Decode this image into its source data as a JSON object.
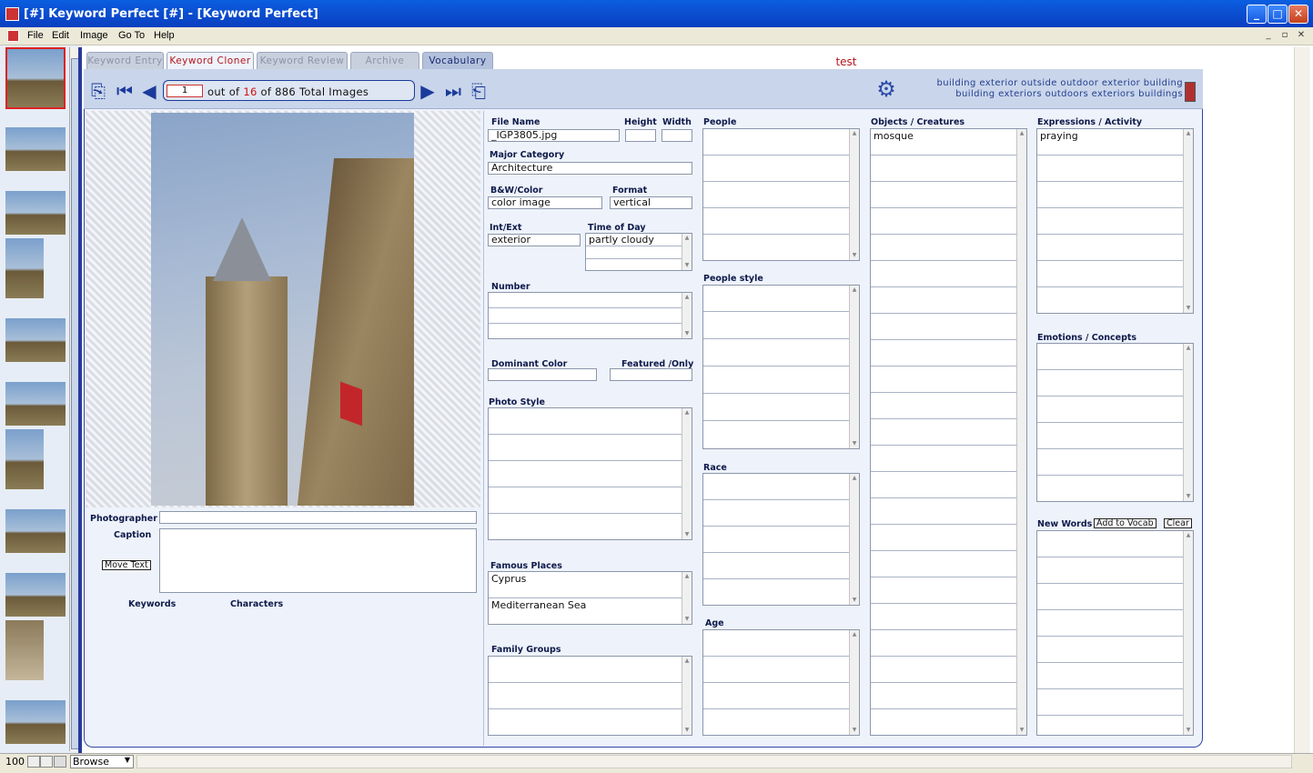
{
  "window": {
    "title": "[#] Keyword Perfect [#] - [Keyword Perfect]",
    "min": "_",
    "max": "□",
    "close": "✕"
  },
  "menu": {
    "items": [
      "File",
      "Edit",
      "Image",
      "Go To",
      "Help"
    ],
    "mdi": [
      "_",
      "▫",
      "✕"
    ]
  },
  "tabs": [
    {
      "label": "Keyword Entry",
      "state": "inactive"
    },
    {
      "label": "Keyword Cloner",
      "state": "active"
    },
    {
      "label": "Keyword Review",
      "state": "inactive"
    },
    {
      "label": "Archive",
      "state": "inactive"
    },
    {
      "label": "Vocabulary",
      "state": "highlight"
    }
  ],
  "test_label": "test",
  "nav": {
    "current": "1",
    "out_of": "out of",
    "count": "16",
    "of_total": "of 886 Total Images"
  },
  "keyword_summary": {
    "line1": "building exterior  outside  outdoor  exterior  building",
    "line2": "building exteriors   outdoors  exteriors  buildings"
  },
  "fields": {
    "file_name_label": "File Name",
    "file_name": "_IGP3805.jpg",
    "height_label": "Height",
    "height": "",
    "width_label": "Width",
    "width": "",
    "major_category_label": "Major Category",
    "major_category": "Architecture",
    "bw_color_label": "B&W/Color",
    "bw_color": "color image",
    "format_label": "Format",
    "format": "vertical",
    "int_ext_label": "Int/Ext",
    "int_ext": "exterior",
    "time_of_day_label": "Time of Day",
    "time_of_day": [
      "partly cloudy",
      "",
      ""
    ],
    "number_label": "Number",
    "dominant_color_label": "Dominant Color",
    "dominant_color": "",
    "featured_label": "Featured /Only",
    "featured": "",
    "photo_style_label": "Photo Style",
    "famous_places_label": "Famous Places",
    "famous_places": [
      "Cyprus",
      "Mediterranean Sea"
    ],
    "family_groups_label": "Family Groups",
    "people_label": "People",
    "people_style_label": "People style",
    "race_label": "Race",
    "age_label": "Age",
    "objects_label": "Objects / Creatures",
    "objects": [
      "mosque"
    ],
    "expressions_label": "Expressions / Activity",
    "expressions": [
      "praying"
    ],
    "emotions_label": "Emotions / Concepts",
    "new_words_label": "New Words",
    "add_to_vocab": "Add to Vocab",
    "clear": "Clear",
    "photographer_label": "Photographer",
    "photographer": "",
    "caption_label": "Caption",
    "caption": "",
    "move_text": "Move Text",
    "keywords_label": "Keywords",
    "characters_label": "Characters"
  },
  "status": {
    "zoom": "100",
    "mode": "Browse"
  },
  "icons": {
    "app": "app-icon",
    "gear": "gear-icon",
    "color_indicator": "#b03030"
  }
}
